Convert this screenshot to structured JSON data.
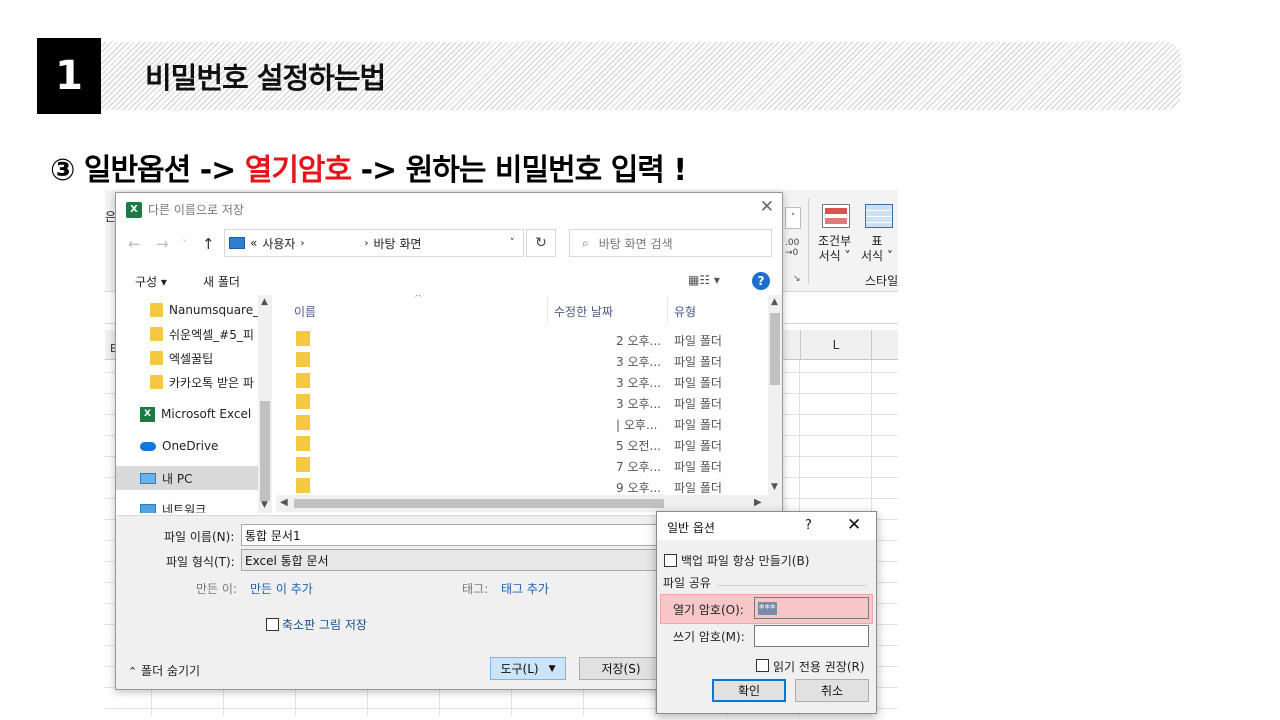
{
  "slide": {
    "number": "1",
    "title": "비밀번호 설정하는법",
    "step": {
      "prefix": "③ 일반옵션 -> ",
      "highlight": "열기암호",
      "suffix": " -> 원하는 비밀번호 입력 !"
    }
  },
  "excel": {
    "ribbon": {
      "conditional_format": "조건부",
      "conditional_format_2": "서식 ˅",
      "table": "표",
      "table_2": "서식 ˅",
      "style_group": "스타일",
      "left_fragment": "은",
      "number_fragment": ".00\n→0"
    },
    "column_header_l": "L",
    "left_fragment": "E"
  },
  "save_dialog": {
    "title": "다른 이름으로 저장",
    "address": {
      "chevron": "«",
      "segment1": "사용자",
      "segment2": "바탕 화면"
    },
    "search_placeholder": "바탕 화면 검색",
    "toolbar": {
      "organize": "구성 ▾",
      "new_folder": "새 폴더",
      "view": "▦☷ ▾"
    },
    "nav_items": [
      {
        "label": "Nanumsquare_a"
      },
      {
        "label": "쉬운엑셀_#5_피"
      },
      {
        "label": "엑셀꿀팁"
      },
      {
        "label": "카카오톡 받은 파"
      },
      {
        "label": "Microsoft Excel"
      },
      {
        "label": "OneDrive"
      },
      {
        "label": "내 PC"
      },
      {
        "label": "네트워크"
      }
    ],
    "columns": {
      "name": "이름",
      "date": "수정한 날짜",
      "type": "유형"
    },
    "files": [
      {
        "date": "2 오후...",
        "type": "파일 폴더"
      },
      {
        "date": "3 오후...",
        "type": "파일 폴더"
      },
      {
        "date": "3 오후...",
        "type": "파일 폴더"
      },
      {
        "date": "3 오후...",
        "type": "파일 폴더"
      },
      {
        "date": "| 오후...",
        "type": "파일 폴더"
      },
      {
        "date": "5 오전...",
        "type": "파일 폴더"
      },
      {
        "date": "7 오후...",
        "type": "파일 폴더"
      },
      {
        "date": "9 오후...",
        "type": "파일 폴더"
      }
    ],
    "file_name_label": "파일 이름(N):",
    "file_name_value": "통합 문서1",
    "file_type_label": "파일 형식(T):",
    "file_type_value": "Excel 통합 문서",
    "author_label": "만든 이:",
    "author_link": "만든 이 추가",
    "tags_label": "태그:",
    "tags_link": "태그 추가",
    "thumbnail_label": "축소판 그림 저장",
    "hide_folders": "폴더 숨기기",
    "tools_button": "도구(L)",
    "save_button": "저장(S)"
  },
  "options_dialog": {
    "title": "일반 옵션",
    "help": "?",
    "close": "✕",
    "backup_label": "백업 파일 항상 만들기(B)",
    "file_sharing": "파일 공유",
    "open_password_label": "열기 암호(O):",
    "open_password_value": "***",
    "modify_password_label": "쓰기 암호(M):",
    "read_only_label": "읽기 전용 권장(R)",
    "ok_button": "확인",
    "cancel_button": "취소"
  }
}
